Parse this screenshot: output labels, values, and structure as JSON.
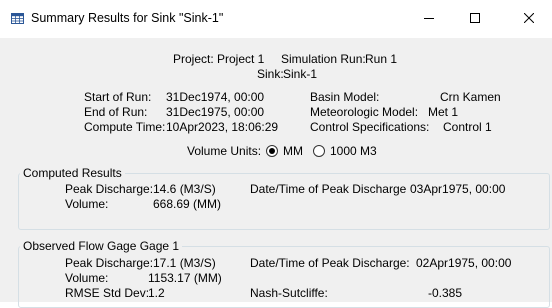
{
  "window": {
    "title": "Summary Results for Sink \"Sink-1\"",
    "icon": "table-icon",
    "controls": {
      "minimize": "minimize-icon",
      "maximize": "maximize-icon",
      "close": "close-icon"
    }
  },
  "header": {
    "project_label": "Project:",
    "project_value": "Project 1",
    "run_label": "Simulation Run:",
    "run_value": "Run 1",
    "sink_label": "Sink:",
    "sink_value": "Sink-1"
  },
  "run_info": {
    "start_label": "Start of Run:",
    "start_value": "31Dec1974, 00:00",
    "end_label": "End of Run:",
    "end_value": "31Dec1975, 00:00",
    "compute_label": "Compute Time:",
    "compute_value": "10Apr2023, 18:06:29",
    "basin_label": "Basin Model:",
    "basin_value": "Crn Kamen",
    "met_label": "Meteorologic Model:",
    "met_value": "Met 1",
    "control_label": "Control Specifications:",
    "control_value": "Control 1"
  },
  "volume_units": {
    "label": "Volume Units:",
    "options": [
      "MM",
      "1000 M3"
    ],
    "selected": "MM"
  },
  "computed": {
    "legend": "Computed Results",
    "peak_label": "Peak Discharge:",
    "peak_value": "14.6 (M3/S)",
    "volume_label": "Volume:",
    "volume_value": "668.69 (MM)",
    "peak_time_label": "Date/Time of Peak Discharge",
    "peak_time_value": "03Apr1975, 00:00"
  },
  "observed": {
    "legend": "Observed Flow Gage Gage 1",
    "peak_label": "Peak Discharge:",
    "peak_value": "17.1 (M3/S)",
    "volume_label": "Volume:",
    "volume_value": "1153.17 (MM)",
    "rmse_label": "RMSE Std Dev:",
    "rmse_value": "1.2",
    "peak_time_label": "Date/Time of Peak Discharge:",
    "peak_time_value": "02Apr1975, 00:00",
    "nash_label": "Nash-Sutcliffe:",
    "nash_value": "-0.385"
  }
}
